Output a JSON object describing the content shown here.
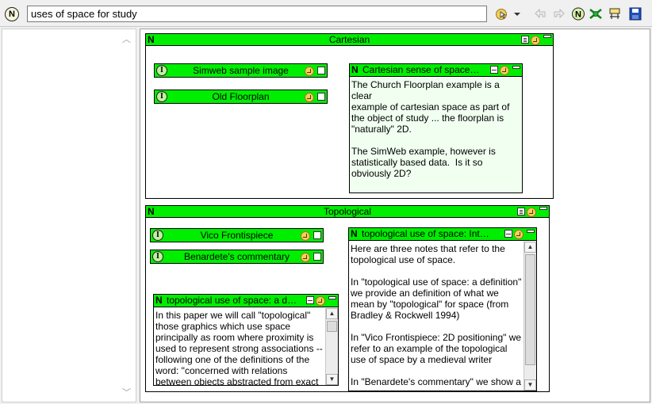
{
  "toolbar": {
    "app_badge": "N",
    "title_value": "uses of space for study",
    "icons": [
      "agent-cursor-icon",
      "dropdown-arrow-icon",
      "back-icon",
      "forward-icon",
      "note-new-icon",
      "link-icon",
      "map-icon",
      "save-icon"
    ]
  },
  "colors": {
    "accent_green": "#00ee00",
    "note_body": "#f0fff0"
  },
  "containers": [
    {
      "badge": "N",
      "title": "Cartesian",
      "items": [
        {
          "badge": "I",
          "label": "Simweb sample image"
        },
        {
          "badge": "I",
          "label": "Old Floorplan"
        }
      ],
      "note": {
        "badge": "N",
        "title": "Cartesian sense of space…",
        "body": "The Church Floorplan example is a clear\nexample of cartesian space as part of\nthe object of study ... the floorplan is\n\"naturally\" 2D.\n\nThe SimWeb example, however is\nstatistically based data.  Is it so\nobviously 2D?"
      }
    },
    {
      "badge": "N",
      "title": "Topological",
      "items": [
        {
          "badge": "I",
          "label": "Vico Frontispiece"
        },
        {
          "badge": "I",
          "label": "Benardete's commentary"
        }
      ],
      "notes": [
        {
          "badge": "N",
          "title": "topological use of space: a d…",
          "body": "In this paper we will call \"topological\"\nthose graphics which use space\nprincipally as room where proximity is\nused to represent strong associations --\nfollowing one of the definitions of the\nword: \"concerned with relations\nbetween objects abstracted from exact"
        },
        {
          "badge": "N",
          "title": "topological use of space: Int…",
          "body": "Here are three notes that refer to the\ntopological use of space.\n\nIn \"topological use of space: a definition\"\nwe provide an definition of what we\nmean by \"topological\" for space (from\nBradley & Rockwell 1994)\n\nIn \"Vico Frontispiece: 2D positioning\" we\nrefer to an example of the topological\nuse of space by a medieval writer\n\nIn \"Benardete's commentary\" we show a"
        }
      ]
    }
  ]
}
